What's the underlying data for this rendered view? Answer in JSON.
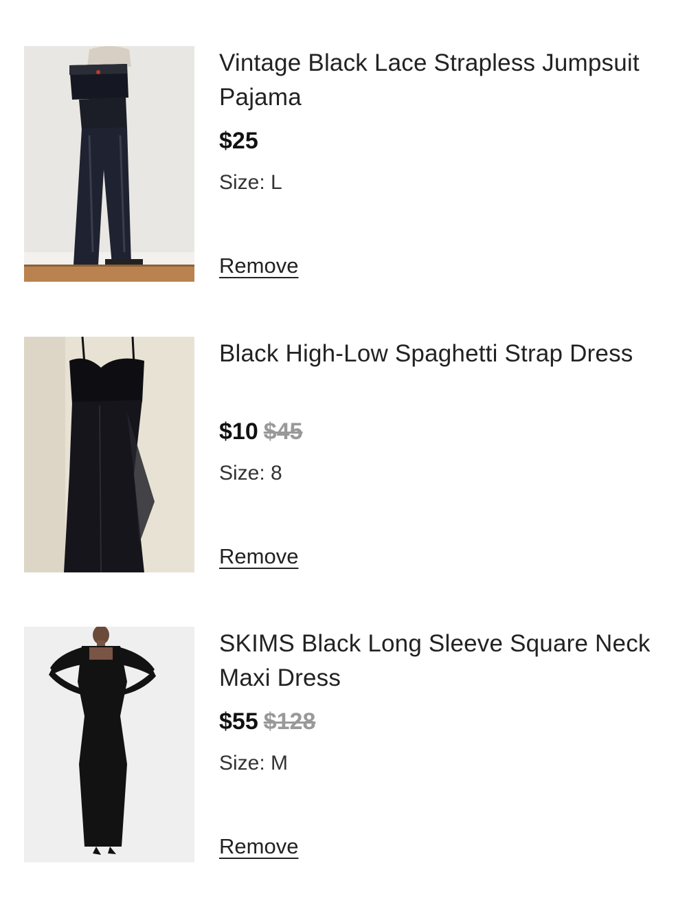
{
  "items": [
    {
      "title": "Vintage Black Lace Strapless Jumpsuit Pajama",
      "price": "$25",
      "original_price": "",
      "size": "Size: L",
      "remove_label": "Remove"
    },
    {
      "title": "Black High-Low Spaghetti Strap Dress",
      "price": "$10",
      "original_price": "$45",
      "size": "Size: 8",
      "remove_label": "Remove"
    },
    {
      "title": "SKIMS Black Long Sleeve Square Neck Maxi Dress",
      "price": "$55",
      "original_price": "$128",
      "size": "Size: M",
      "remove_label": "Remove"
    }
  ],
  "colors": {
    "text": "#222222",
    "strike_price": "#999999"
  }
}
